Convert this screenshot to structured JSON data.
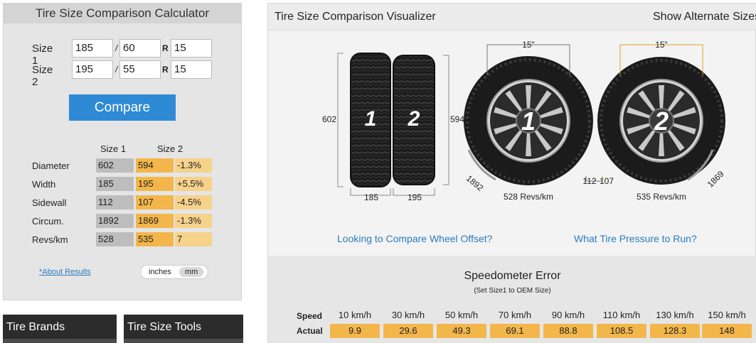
{
  "calculator": {
    "title": "Tire Size Comparison Calculator",
    "size1": {
      "label": "Size 1",
      "width": "185",
      "aspect": "60",
      "rim": "15"
    },
    "size2": {
      "label": "Size 2",
      "width": "195",
      "aspect": "55",
      "rim": "15"
    },
    "sep_slash": "/",
    "sep_r": "R",
    "compare_label": "Compare",
    "results": {
      "col1": "Size 1",
      "col2": "Size 2",
      "rows": [
        {
          "label": "Diameter",
          "s1": "602",
          "s2": "594",
          "diff": "-1.3%"
        },
        {
          "label": "Width",
          "s1": "185",
          "s2": "195",
          "diff": "+5.5%"
        },
        {
          "label": "Sidewall",
          "s1": "112",
          "s2": "107",
          "diff": "-4.5%"
        },
        {
          "label": "Circum.",
          "s1": "1892",
          "s2": "1869",
          "diff": "-1.3%"
        },
        {
          "label": "Revs/km",
          "s1": "528",
          "s2": "535",
          "diff": "7"
        }
      ]
    },
    "about_link": "*About Results",
    "units": {
      "inches": "inches",
      "mm": "mm",
      "selected": "mm"
    }
  },
  "side_tabs": {
    "brands": "Tire Brands",
    "tools": "Tire Size Tools"
  },
  "visualizer": {
    "title": "Tire Size Comparison Visualizer",
    "alternate": "Show Alternate Sizes",
    "side": {
      "height1": "602",
      "height2": "594",
      "width1": "185",
      "width2": "195",
      "num1": "1",
      "num2": "2"
    },
    "wheel1": {
      "rim": "15\"",
      "num": "1",
      "circum": "1892",
      "sidewall": "112",
      "revs": "528 Revs/km"
    },
    "wheel2": {
      "rim": "15\"",
      "num": "2",
      "circum": "1869",
      "sidewall": "107",
      "revs": "535 Revs/km"
    },
    "link_offset": "Looking to Compare Wheel Offset?",
    "link_pressure": "What Tire Pressure to Run?"
  },
  "speedometer": {
    "title": "Speedometer Error",
    "subtitle": "(Set Size1 to OEM Size)",
    "speed_label": "Speed",
    "actual_label": "Actual",
    "speeds": [
      "10 km/h",
      "30 km/h",
      "50 km/h",
      "70 km/h",
      "90 km/h",
      "110 km/h",
      "130 km/h",
      "150 km/h"
    ],
    "actual": [
      "9.9",
      "29.6",
      "49.3",
      "69.1",
      "88.8",
      "108.5",
      "128.3",
      "148"
    ]
  },
  "colors": {
    "accent": "#2f8ad6",
    "highlight": "#f2b64a",
    "highlight_light": "#f7d28a",
    "gray_cell": "#bdbdbd",
    "link": "#2b7bbf"
  }
}
